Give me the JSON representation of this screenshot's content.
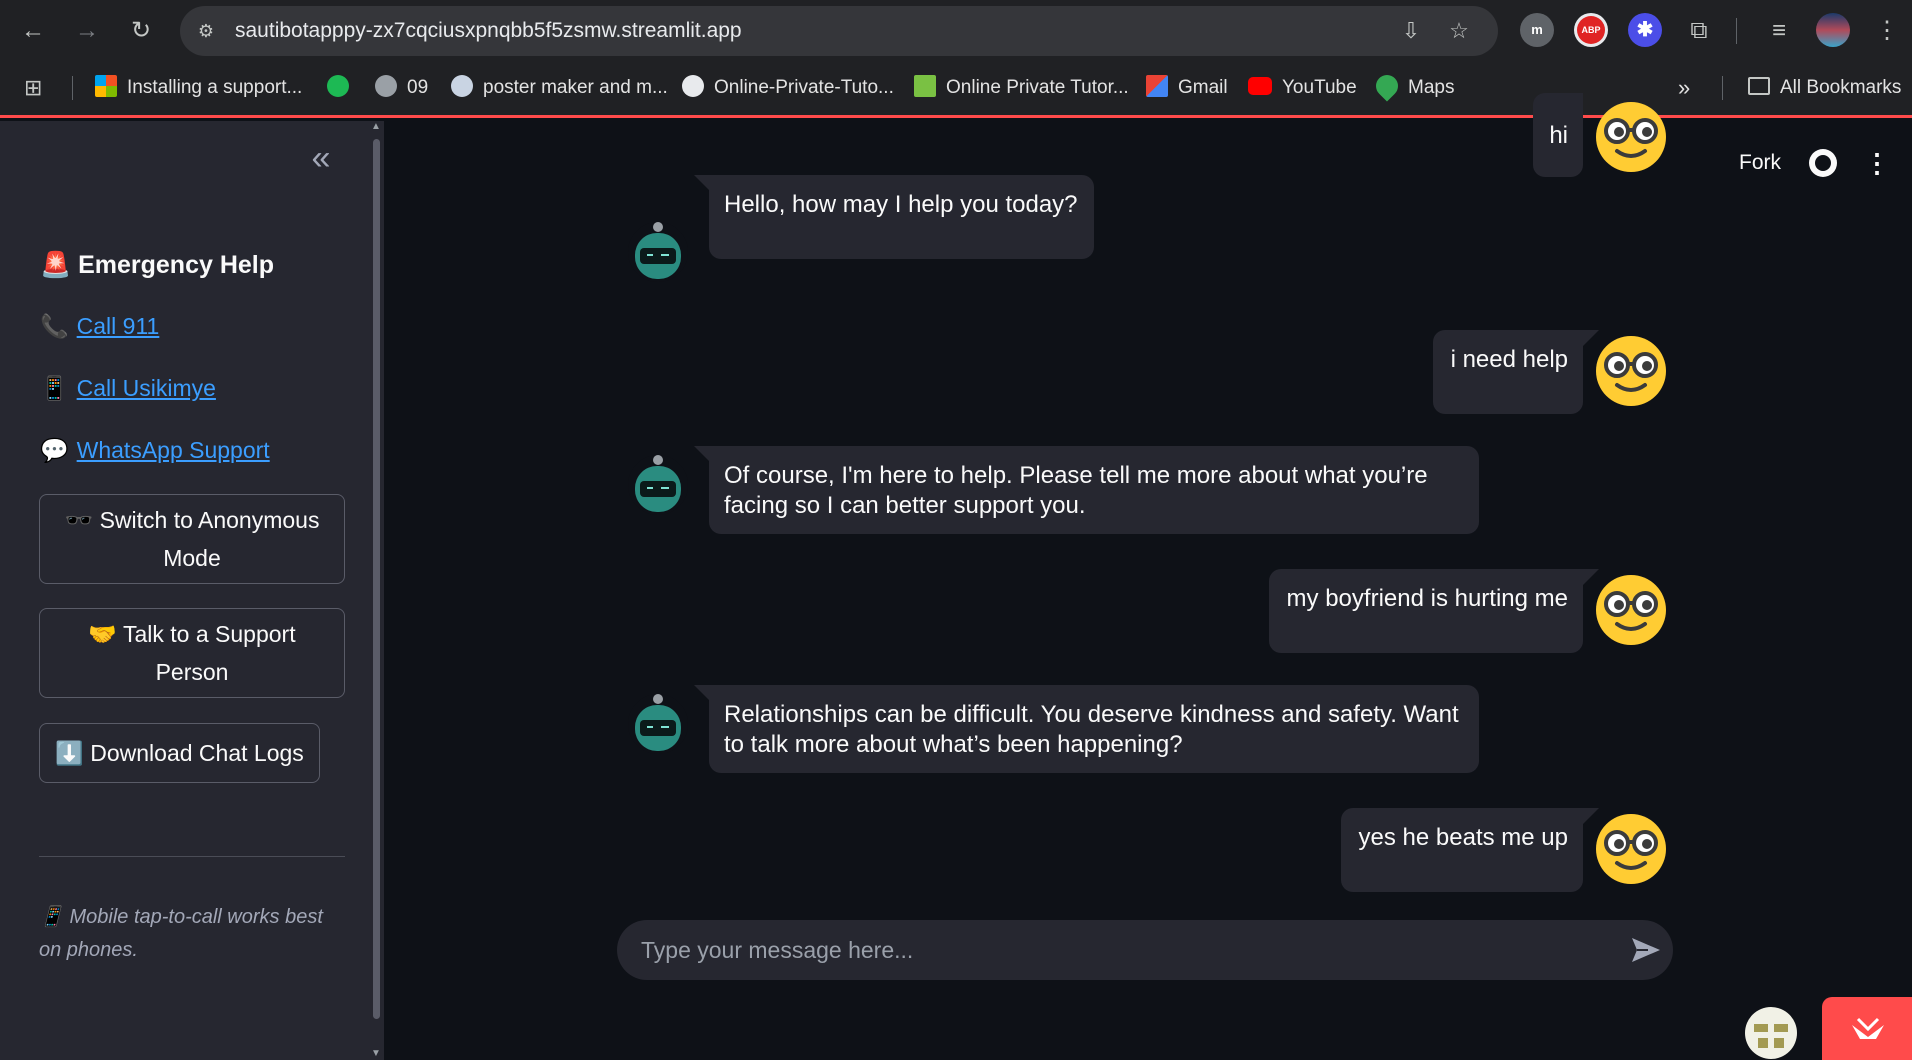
{
  "browser": {
    "url": "sautibotapppy-zx7cqciusxpnqbb5f5zsmw.streamlit.app",
    "bookmarks": [
      {
        "label": "Installing a support...",
        "icon": "windows-tiles-icon"
      },
      {
        "label": "",
        "icon": "spotify-icon"
      },
      {
        "label": "09",
        "icon": "globe-icon"
      },
      {
        "label": "poster maker and m...",
        "icon": "paw-icon"
      },
      {
        "label": "Online-Private-Tuto...",
        "icon": "github-icon"
      },
      {
        "label": "Online Private Tutor...",
        "icon": "leaf-icon"
      },
      {
        "label": "Gmail",
        "icon": "gmail-icon"
      },
      {
        "label": "YouTube",
        "icon": "youtube-icon"
      },
      {
        "label": "Maps",
        "icon": "maps-pin-icon"
      }
    ],
    "all_bookmarks": "All Bookmarks",
    "extensions": {
      "m": "m",
      "abp": "ABP"
    }
  },
  "sidebar": {
    "title": "Emergency Help",
    "title_emoji": "🚨",
    "links": [
      {
        "emoji": "📞",
        "label": "Call 911"
      },
      {
        "emoji": "📱",
        "label": "Call Usikimye"
      },
      {
        "emoji": "💬",
        "label": "WhatsApp Support"
      }
    ],
    "buttons": {
      "anonymous": {
        "emoji": "🕶️",
        "line1": "Switch to Anonymous",
        "line2": "Mode"
      },
      "support": {
        "emoji": "🤝",
        "line1": "Talk to a Support",
        "line2": "Person"
      },
      "download": {
        "emoji": "⬇️",
        "label": "Download Chat Logs"
      }
    },
    "note_emoji": "📱",
    "note": "Mobile tap-to-call works best on phones."
  },
  "header": {
    "fork_label": "Fork"
  },
  "chat": {
    "messages": [
      {
        "role": "user",
        "text": "hi"
      },
      {
        "role": "bot",
        "text": "Hello, how may I help you today?"
      },
      {
        "role": "user",
        "text": "i need help"
      },
      {
        "role": "bot",
        "text": "Of course, I'm here to help. Please tell me more about what you’re facing so I can better support you."
      },
      {
        "role": "user",
        "text": "my boyfriend is hurting me"
      },
      {
        "role": "bot",
        "text": "Relationships can be difficult. You deserve kindness and safety. Want to talk more about what’s been happening?"
      },
      {
        "role": "user",
        "text": "yes he beats me up"
      }
    ],
    "input_placeholder": "Type your message here..."
  },
  "colors": {
    "accent": "#ff4b4b",
    "link": "#3b9eff",
    "bubble": "#262730",
    "background": "#0e1117",
    "sidebar": "#262730"
  }
}
